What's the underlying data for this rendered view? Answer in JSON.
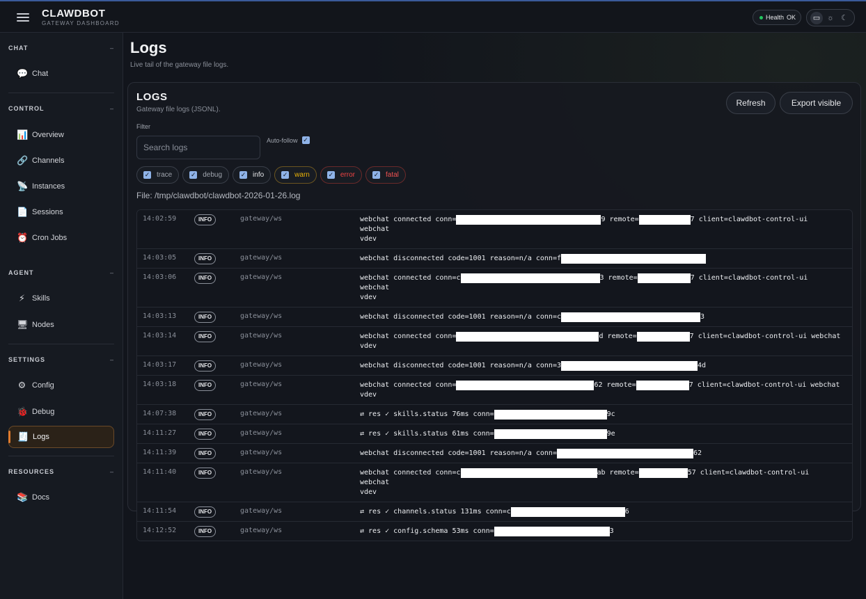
{
  "app": {
    "name": "CLAWDBOT",
    "subtitle": "GATEWAY DASHBOARD",
    "health_label": "Health",
    "health_status": "OK",
    "health_color": "#22c55e",
    "accent_color": "#e07b2d"
  },
  "sidebar": {
    "sections": [
      {
        "title": "CHAT",
        "items": [
          {
            "label": "Chat",
            "icon": "speech-bubble-icon"
          }
        ]
      },
      {
        "title": "CONTROL",
        "items": [
          {
            "label": "Overview",
            "icon": "bar-chart-icon"
          },
          {
            "label": "Channels",
            "icon": "link-icon"
          },
          {
            "label": "Instances",
            "icon": "satellite-icon"
          },
          {
            "label": "Sessions",
            "icon": "document-icon"
          },
          {
            "label": "Cron Jobs",
            "icon": "alarm-clock-icon"
          }
        ]
      },
      {
        "title": "AGENT",
        "items": [
          {
            "label": "Skills",
            "icon": "lightning-icon"
          },
          {
            "label": "Nodes",
            "icon": "monitor-icon"
          }
        ]
      },
      {
        "title": "SETTINGS",
        "items": [
          {
            "label": "Config",
            "icon": "gear-icon"
          },
          {
            "label": "Debug",
            "icon": "bug-icon"
          },
          {
            "label": "Logs",
            "icon": "receipt-icon",
            "active": true
          }
        ]
      },
      {
        "title": "RESOURCES",
        "items": [
          {
            "label": "Docs",
            "icon": "books-icon"
          }
        ]
      }
    ]
  },
  "page": {
    "title": "Logs",
    "subtitle": "Live tail of the gateway file logs."
  },
  "card": {
    "title": "LOGS",
    "subtitle": "Gateway file logs (JSONL).",
    "refresh_label": "Refresh",
    "export_label": "Export visible",
    "filter_label": "Filter",
    "search_placeholder": "Search logs",
    "autofollow_label": "Auto-follow",
    "levels": [
      {
        "label": "trace",
        "checked": true
      },
      {
        "label": "debug",
        "checked": true
      },
      {
        "label": "info",
        "checked": true
      },
      {
        "label": "warn",
        "checked": true
      },
      {
        "label": "error",
        "checked": true
      },
      {
        "label": "fatal",
        "checked": true
      }
    ],
    "file_label": "File: /tmp/clawdbot/clawdbot-2026-01-26.log"
  },
  "logs": [
    {
      "time": "14:02:59",
      "level": "INFO",
      "subsystem": "gateway/ws",
      "message": [
        "webchat connected conn=",
        {
          "redact": 208
        },
        "9 remote=",
        {
          "redact": 74
        },
        "7 client=clawdbot-control-ui webchat\nvdev"
      ]
    },
    {
      "time": "14:03:05",
      "level": "INFO",
      "subsystem": "gateway/ws",
      "message": [
        "webchat disconnected code=1001 reason=n/a conn=f",
        {
          "redact": 208
        }
      ]
    },
    {
      "time": "14:03:06",
      "level": "INFO",
      "subsystem": "gateway/ws",
      "message": [
        "webchat connected conn=c",
        {
          "redact": 200
        },
        "3 remote=",
        {
          "redact": 76
        },
        "7 client=clawdbot-control-ui webchat\nvdev"
      ]
    },
    {
      "time": "14:03:13",
      "level": "INFO",
      "subsystem": "gateway/ws",
      "message": [
        "webchat disconnected code=1001 reason=n/a conn=c",
        {
          "redact": 200
        },
        "3"
      ]
    },
    {
      "time": "14:03:14",
      "level": "INFO",
      "subsystem": "gateway/ws",
      "message": [
        "webchat connected conn=",
        {
          "redact": 205
        },
        "d remote=",
        {
          "redact": 76
        },
        "7 client=clawdbot-control-ui webchat\nvdev"
      ]
    },
    {
      "time": "14:03:17",
      "level": "INFO",
      "subsystem": "gateway/ws",
      "message": [
        "webchat disconnected code=1001 reason=n/a conn=3",
        {
          "redact": 196
        },
        "4d"
      ]
    },
    {
      "time": "14:03:18",
      "level": "INFO",
      "subsystem": "gateway/ws",
      "message": [
        "webchat connected conn=",
        {
          "redact": 198
        },
        "62 remote=",
        {
          "redact": 76
        },
        "7 client=clawdbot-control-ui webchat\nvdev"
      ]
    },
    {
      "time": "14:07:38",
      "level": "INFO",
      "subsystem": "gateway/ws",
      "message": [
        "⇄ res ✓ skills.status 76ms conn=",
        {
          "redact": 162
        },
        "9c"
      ]
    },
    {
      "time": "14:11:27",
      "level": "INFO",
      "subsystem": "gateway/ws",
      "message": [
        "⇄ res ✓ skills.status 61ms conn=",
        {
          "redact": 162
        },
        "9e"
      ]
    },
    {
      "time": "14:11:39",
      "level": "INFO",
      "subsystem": "gateway/ws",
      "message": [
        "webchat disconnected code=1001 reason=n/a conn=",
        {
          "redact": 196
        },
        "62"
      ]
    },
    {
      "time": "14:11:40",
      "level": "INFO",
      "subsystem": "gateway/ws",
      "message": [
        "webchat connected conn=c",
        {
          "redact": 196
        },
        "ab remote=",
        {
          "redact": 70
        },
        "57 client=clawdbot-control-ui webchat\nvdev"
      ]
    },
    {
      "time": "14:11:54",
      "level": "INFO",
      "subsystem": "gateway/ws",
      "message": [
        "⇄ res ✓ channels.status 131ms conn=c",
        {
          "redact": 164
        },
        "6"
      ]
    },
    {
      "time": "14:12:52",
      "level": "INFO",
      "subsystem": "gateway/ws",
      "message": [
        "⇄ res ✓ config.schema 53ms conn=",
        {
          "redact": 166
        },
        "3"
      ]
    }
  ]
}
